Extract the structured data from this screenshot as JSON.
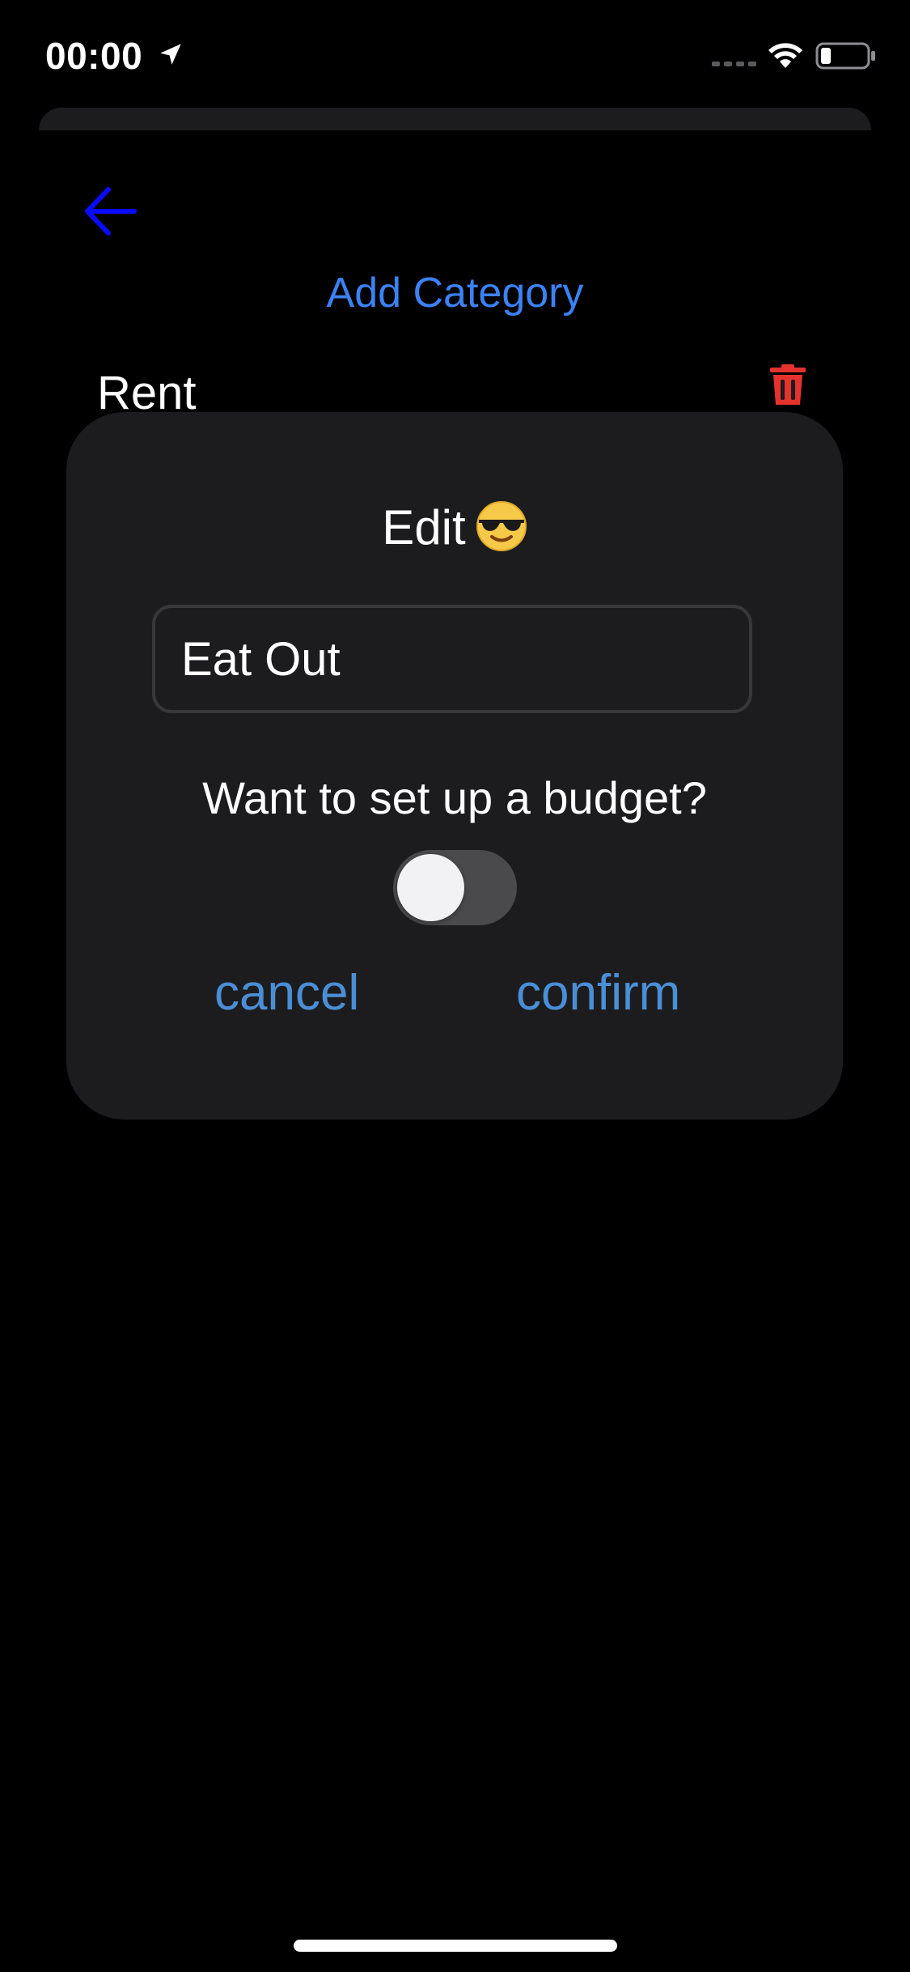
{
  "status_bar": {
    "time": "00:00",
    "icons": [
      "location-arrow-icon",
      "cellular-signal-icon",
      "wifi-icon",
      "battery-icon"
    ]
  },
  "header": {
    "back_icon": "arrow-left-icon",
    "add_category_label": "Add Category"
  },
  "categories": [
    {
      "label": "Rent",
      "delete_icon": "trash-icon"
    }
  ],
  "modal": {
    "title": "Edit",
    "title_emoji": "smiling-face-with-sunglasses",
    "name_field_value": "Eat Out",
    "budget_question": "Want to set up a budget?",
    "budget_toggle_on": false,
    "cancel_label": "cancel",
    "confirm_label": "confirm"
  },
  "colors": {
    "background": "#000000",
    "card": "#1c1c1e",
    "accent_blue": "#3b82f6",
    "back_arrow_blue": "#0a0aff",
    "action_blue": "#4a8fd6",
    "delete_red": "#e5322d",
    "toggle_off": "#4a4a4c"
  }
}
